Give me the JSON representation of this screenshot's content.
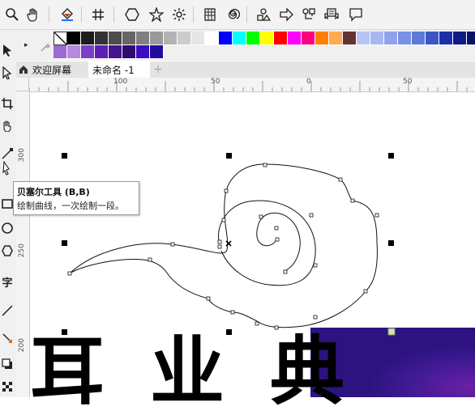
{
  "toolbar": {
    "icons": [
      "zoom-icon",
      "pan-hand-icon",
      "fill-bucket-icon",
      "grid-snap-icon",
      "hexagon-icon",
      "star-icon",
      "gear-icon",
      "spreadsheet-icon",
      "spiral-icon",
      "shapes-icon",
      "arrow-shape-icon",
      "flowchart-icon",
      "banner-icon",
      "callout-icon"
    ]
  },
  "palette": {
    "row1": [
      "#ffffff",
      "#000000",
      "#1c1c1c",
      "#333333",
      "#4d4d4d",
      "#666666",
      "#808080",
      "#999999",
      "#b3b3b3",
      "#cccccc",
      "#e6e6e6",
      "#ffffff",
      "#0000ff",
      "#00ffff",
      "#00ff00",
      "#ffff00",
      "#ff0000",
      "#ff00ff",
      "#ff0080",
      "#ff8000",
      "#ffaa55",
      "#663333",
      "#b7c4f5",
      "#a7b7f1",
      "#8fa3ec",
      "#7891e6",
      "#5e7ad6",
      "#3b56c4",
      "#1b2fa8",
      "#0f1c85",
      "#0a1466"
    ],
    "row2": [
      "#9b6bd4",
      "#b68ae0",
      "#7a3fc7",
      "#5e1fb3",
      "#47148f",
      "#2f0b6e",
      "#3b0fbf",
      "#200d9e"
    ]
  },
  "tabs": {
    "welcome": "欢迎屏幕",
    "document": "未命名 -1",
    "add": "+"
  },
  "ruler": {
    "h_labels": [
      "100",
      "50",
      "0",
      "50"
    ],
    "v_labels": [
      "300",
      "250",
      "200"
    ]
  },
  "tooltip": {
    "title": "贝塞尔工具 (B,B)",
    "description": "绘制曲线，一次绘制一段。"
  },
  "canvas": {
    "large_text": "耳 业 典"
  },
  "colors": {
    "purple_object": "#3a1a8c",
    "selection_handle": "#000000"
  }
}
